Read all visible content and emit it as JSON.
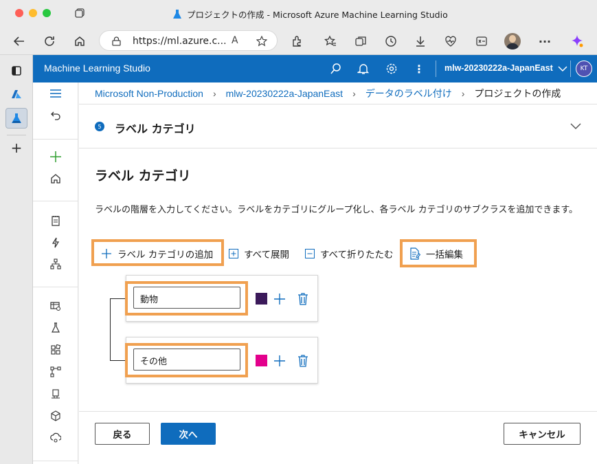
{
  "browser": {
    "tab_title": "プロジェクトの作成 - Microsoft Azure Machine Learning Studio",
    "url": "https://ml.azure.c..."
  },
  "header": {
    "app_title": "Machine Learning Studio",
    "workspace": "mlw-20230222a-JapanEast",
    "avatar_initials": "KT"
  },
  "breadcrumb": {
    "items": [
      "Microsoft Non-Production",
      "mlw-20230222a-JapanEast",
      "データのラベル付け"
    ],
    "current": "プロジェクトの作成"
  },
  "step": {
    "number": "5",
    "title": "ラベル カテゴリ"
  },
  "section": {
    "title": "ラベル カテゴリ",
    "description": "ラベルの階層を入力してください。ラベルをカテゴリにグループ化し、各ラベル カテゴリのサブクラスを追加できます。"
  },
  "actions": {
    "add_category": "ラベル カテゴリの追加",
    "expand_all": "すべて展開",
    "collapse_all": "すべて折りたたむ",
    "bulk_edit": "一括編集"
  },
  "categories": [
    {
      "name": "動物",
      "color": "#3b1a5a"
    },
    {
      "name": "その他",
      "color": "#e3008c"
    }
  ],
  "footer": {
    "back": "戻る",
    "next": "次へ",
    "cancel": "キャンセル"
  },
  "colors": {
    "accent": "#0f6cbd",
    "highlight": "#f0a050"
  }
}
